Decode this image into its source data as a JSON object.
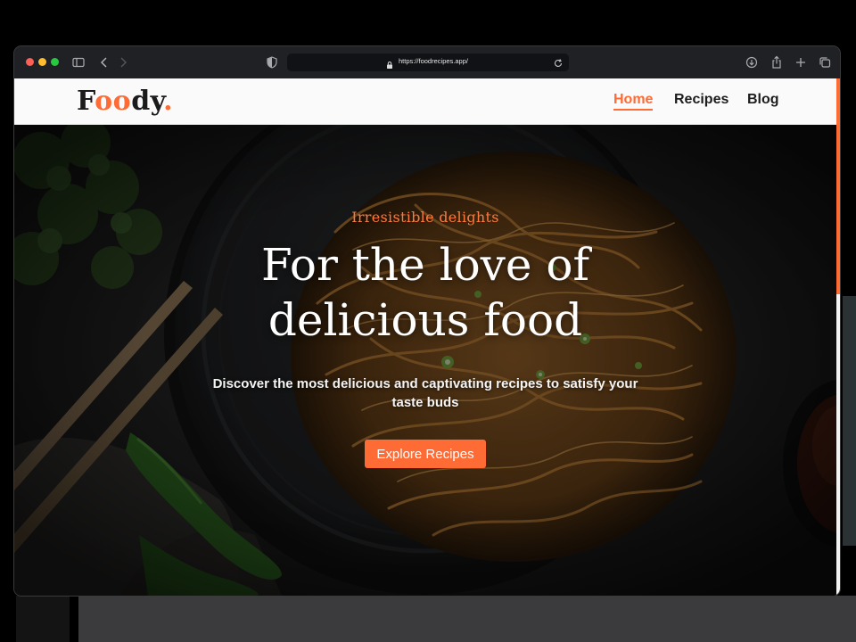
{
  "browser": {
    "url": "https://foodrecipes.app/"
  },
  "brand": {
    "logo_parts": [
      "F",
      "oo",
      "dy",
      "."
    ],
    "accent_color": "#ff6b35"
  },
  "nav": {
    "items": [
      {
        "label": "Home",
        "active": true
      },
      {
        "label": "Recipes",
        "active": false
      },
      {
        "label": "Blog",
        "active": false
      }
    ]
  },
  "hero": {
    "eyebrow": "Irresistible delights",
    "headline_line1": "For the love of",
    "headline_line2": "delicious food",
    "subtext": "Discover the most delicious and captivating recipes to satisfy your taste buds",
    "cta_label": "Explore Recipes"
  },
  "icons": {
    "titlebar": [
      "sidebar-toggle-icon",
      "back-chevron-icon",
      "forward-chevron-icon",
      "shield-icon",
      "lock-icon",
      "reload-icon",
      "download-icon",
      "share-icon",
      "new-tab-plus-icon",
      "tab-overview-icon"
    ]
  }
}
